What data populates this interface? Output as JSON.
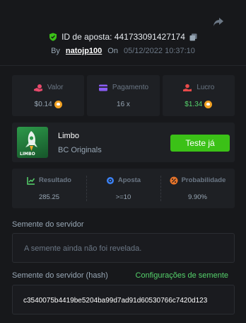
{
  "bet": {
    "id_label": "ID de aposta: 441733091427174",
    "by_label": "By",
    "user": "natojp100",
    "on_label": "On",
    "datetime": "05/12/2022 10:37:10"
  },
  "stats": [
    {
      "label": "Valor",
      "value": "$0.14",
      "icon": "coin-hand-icon",
      "color": "#e84a6c",
      "value_color": "#98a7b5"
    },
    {
      "label": "Pagamento",
      "value": "16 x",
      "icon": "card-icon",
      "color": "#8a5cf6",
      "value_color": "#98a7b5"
    },
    {
      "label": "Lucro",
      "value": "$1.34",
      "icon": "profit-icon",
      "color": "#e84a4a",
      "value_color": "#55d26b"
    }
  ],
  "game": {
    "name": "Limbo",
    "provider": "BC Originals",
    "try_label": "Teste já",
    "thumb_text": "LIMBO"
  },
  "metrics": [
    {
      "label": "Resultado",
      "value": "285.25",
      "icon": "result-chart-icon",
      "color": "#55d26b"
    },
    {
      "label": "Aposta",
      "value": ">=10",
      "icon": "target-icon",
      "color": "#3b82f6"
    },
    {
      "label": "Probabilidade",
      "value": "9.90%",
      "icon": "percent-icon",
      "color": "#e8742a"
    }
  ],
  "server_seed": {
    "title": "Semente do servidor",
    "value": "A semente ainda não foi revelada."
  },
  "server_seed_hash": {
    "title": "Semente do servidor (hash)",
    "settings_label": "Configurações de semente",
    "value": "c3540075b4419be5204ba99d7ad91d60530766c7420d123"
  },
  "colors": {
    "accent_green": "#3bc117",
    "background": "#17181b",
    "card": "#1e2024"
  }
}
